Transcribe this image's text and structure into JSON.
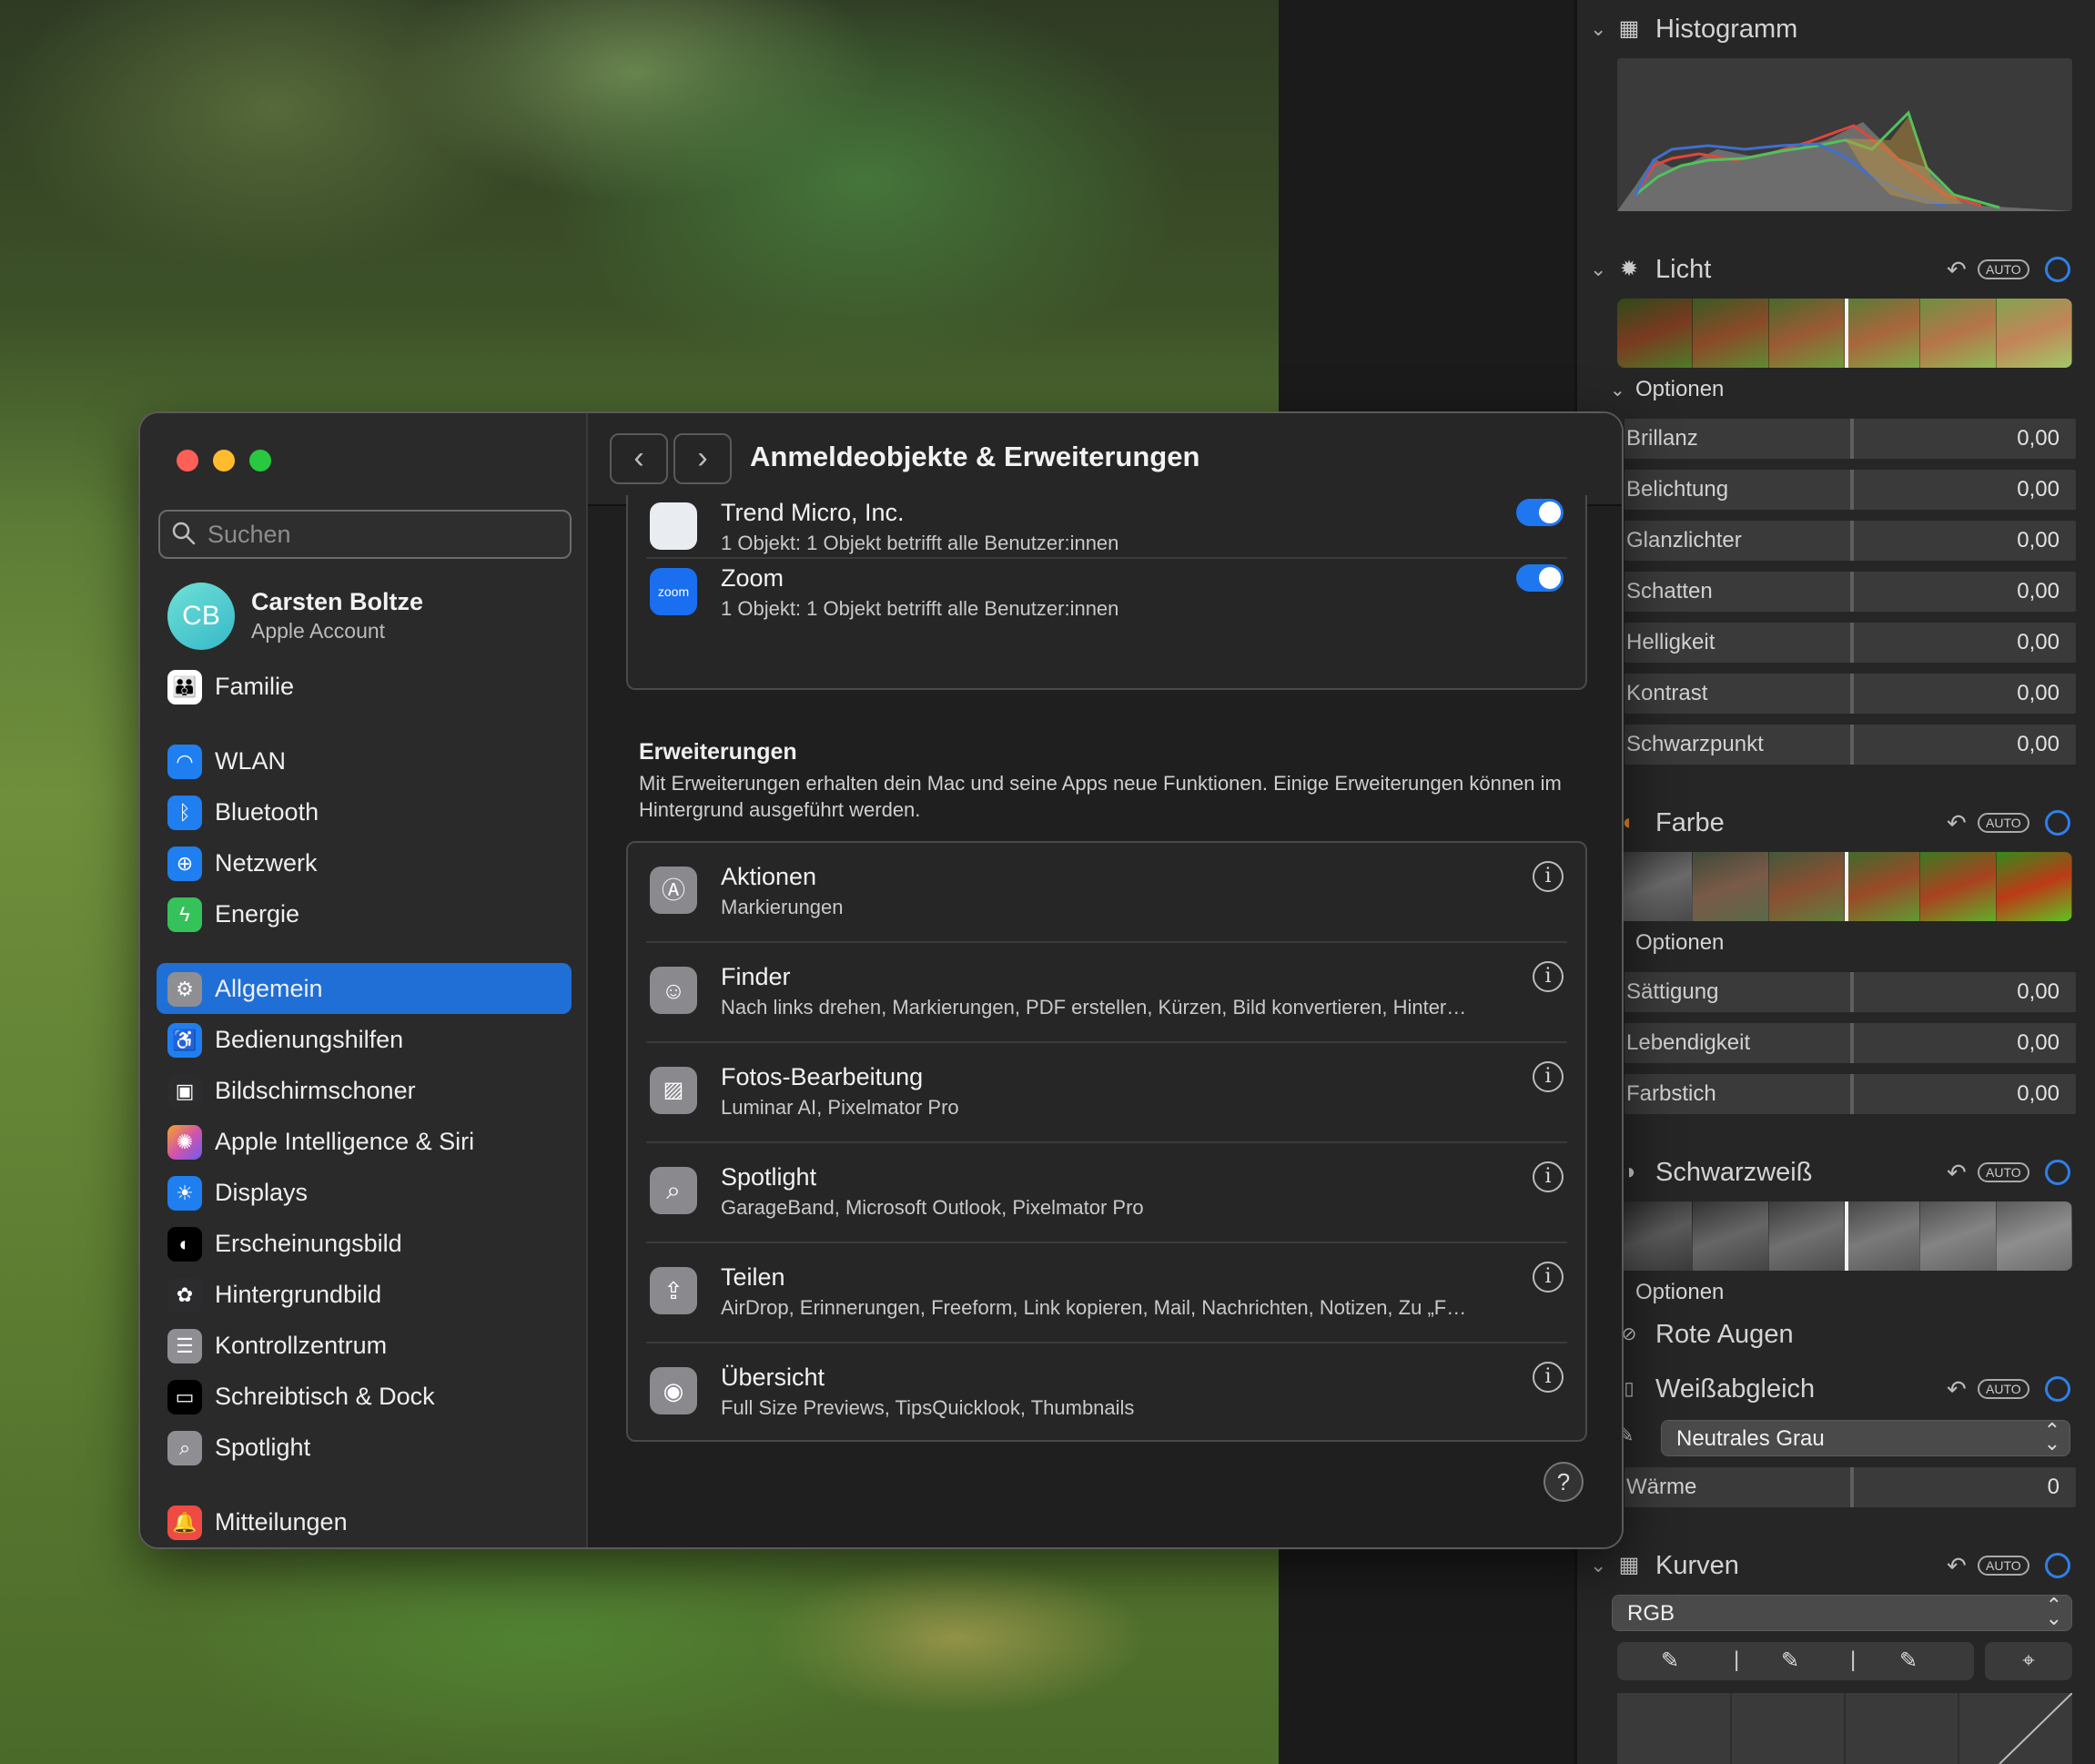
{
  "right_panel": {
    "histogram": {
      "title": "Histogramm"
    },
    "licht": {
      "title": "Licht",
      "auto": "AUTO",
      "options_label": "Optionen",
      "sliders": [
        {
          "label": "Brillanz",
          "value": "0,00"
        },
        {
          "label": "Belichtung",
          "value": "0,00"
        },
        {
          "label": "Glanzlichter",
          "value": "0,00"
        },
        {
          "label": "Schatten",
          "value": "0,00"
        },
        {
          "label": "Helligkeit",
          "value": "0,00"
        },
        {
          "label": "Kontrast",
          "value": "0,00"
        },
        {
          "label": "Schwarzpunkt",
          "value": "0,00"
        }
      ]
    },
    "farbe": {
      "title": "Farbe",
      "auto": "AUTO",
      "options_label": "Optionen",
      "sliders": [
        {
          "label": "Sättigung",
          "value": "0,00"
        },
        {
          "label": "Lebendigkeit",
          "value": "0,00"
        },
        {
          "label": "Farbstich",
          "value": "0,00"
        }
      ]
    },
    "schwarzweiss": {
      "title": "Schwarzweiß",
      "auto": "AUTO",
      "options_label": "Optionen"
    },
    "rote_augen": {
      "title": "Rote Augen"
    },
    "weissabgleich": {
      "title": "Weißabgleich",
      "auto": "AUTO",
      "mode": "Neutrales Grau",
      "slider": {
        "label": "Wärme",
        "value": "0"
      }
    },
    "kurven": {
      "title": "Kurven",
      "auto": "AUTO",
      "channel": "RGB"
    }
  },
  "window": {
    "search_placeholder": "Suchen",
    "account": {
      "initials": "CB",
      "name": "Carsten Boltze",
      "subtitle": "Apple Account"
    },
    "sidebar": [
      {
        "label": "Familie",
        "icon": "family-icon",
        "color": "#4a90e2"
      },
      {
        "label": "WLAN",
        "icon": "wifi-icon",
        "color": "#1f7ff0"
      },
      {
        "label": "Bluetooth",
        "icon": "bluetooth-icon",
        "color": "#1f7ff0"
      },
      {
        "label": "Netzwerk",
        "icon": "globe-icon",
        "color": "#1f7ff0"
      },
      {
        "label": "Energie",
        "icon": "bolt-icon",
        "color": "#35c25a"
      },
      {
        "label": "Allgemein",
        "icon": "gear-icon",
        "color": "#8e8e93",
        "active": true
      },
      {
        "label": "Bedienungshilfen",
        "icon": "accessibility-icon",
        "color": "#1f7ff0"
      },
      {
        "label": "Bildschirmschoner",
        "icon": "screensaver-icon",
        "color": "#2c2c2e"
      },
      {
        "label": "Apple Intelligence & Siri",
        "icon": "siri-icon",
        "color": "#d455a8"
      },
      {
        "label": "Displays",
        "icon": "sun-icon",
        "color": "#1f7ff0"
      },
      {
        "label": "Erscheinungsbild",
        "icon": "appearance-icon",
        "color": "#000000"
      },
      {
        "label": "Hintergrundbild",
        "icon": "flower-icon",
        "color": "#2c2c2e"
      },
      {
        "label": "Kontrollzentrum",
        "icon": "toggles-icon",
        "color": "#8e8e93"
      },
      {
        "label": "Schreibtisch & Dock",
        "icon": "dock-icon",
        "color": "#000000"
      },
      {
        "label": "Spotlight",
        "icon": "magnifier-icon",
        "color": "#8e8e93"
      },
      {
        "label": "Mitteilungen",
        "icon": "bell-icon",
        "color": "#f04a44"
      }
    ],
    "title": "Anmeldeobjekte & Erweiterungen",
    "login_items": [
      {
        "title": "Trend Micro, Inc.",
        "subtitle": "1 Objekt: 1 Objekt betrifft alle Benutzer:innen",
        "enabled": true
      },
      {
        "title": "Zoom",
        "subtitle": "1 Objekt: 1 Objekt betrifft alle Benutzer:innen",
        "enabled": true,
        "badge": "zoom"
      }
    ],
    "extensions_heading": "Erweiterungen",
    "extensions_description": "Mit Erweiterungen erhalten dein Mac und seine Apps neue Funktionen. Einige Erweiterungen können im Hintergrund ausgeführt werden.",
    "extensions": [
      {
        "title": "Aktionen",
        "subtitle": "Markierungen",
        "icon": "actions-icon"
      },
      {
        "title": "Finder",
        "subtitle": "Nach links drehen, Markierungen, PDF erstellen, Kürzen, Bild konvertieren, Hinter…",
        "icon": "finder-icon"
      },
      {
        "title": "Fotos-Bearbeitung",
        "subtitle": "Luminar AI, Pixelmator Pro",
        "icon": "photos-icon"
      },
      {
        "title": "Spotlight",
        "subtitle": "GarageBand, Microsoft Outlook, Pixelmator Pro",
        "icon": "spotlight-icon"
      },
      {
        "title": "Teilen",
        "subtitle": "AirDrop, Erinnerungen, Freeform, Link kopieren, Mail, Nachrichten, Notizen, Zu „F…",
        "icon": "share-icon"
      },
      {
        "title": "Übersicht",
        "subtitle": "Full Size Previews, TipsQuicklook, Thumbnails",
        "icon": "eye-icon"
      }
    ],
    "help": "?"
  }
}
